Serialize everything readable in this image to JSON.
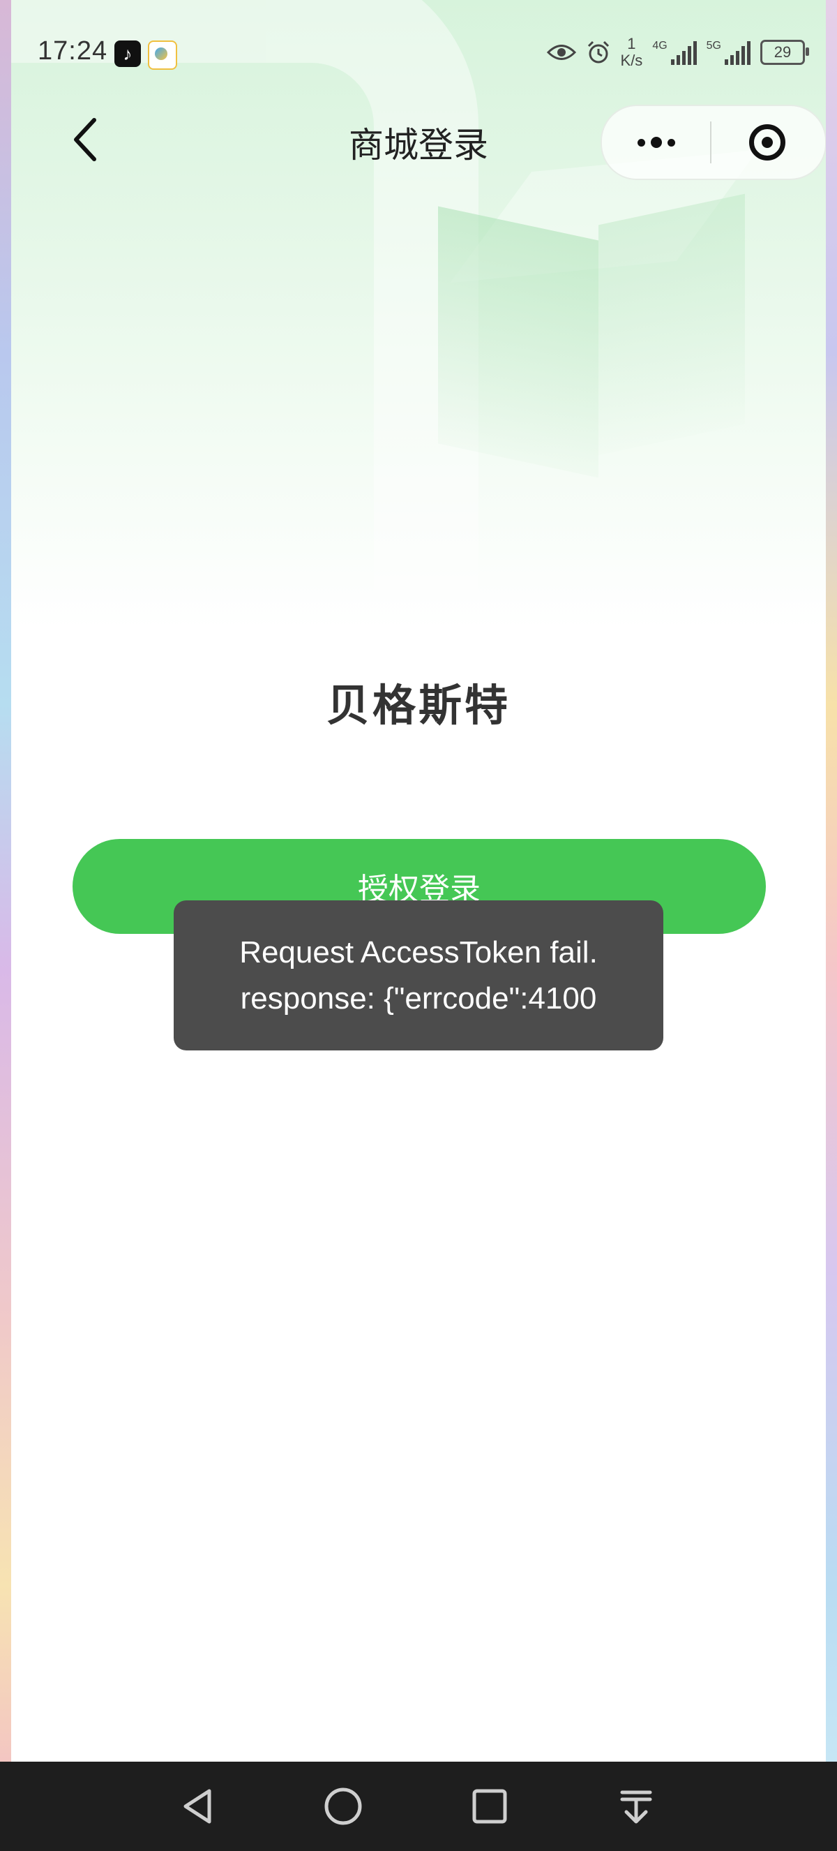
{
  "status_bar": {
    "time": "17:24",
    "net_speed_value": "1",
    "net_speed_unit": "K/s",
    "signal_1_label": "4G",
    "signal_2_label": "5G",
    "battery": "29"
  },
  "nav": {
    "title": "商城登录"
  },
  "page": {
    "brand_name": "贝格斯特",
    "login_button_label": "授权登录"
  },
  "toast": {
    "line1": "Request AccessToken fail.",
    "line2": "response: {\"errcode\":4100"
  },
  "colors": {
    "primary_green": "#45c755",
    "toast_bg": "#4c4c4c",
    "system_nav_bg": "#1e1e1e"
  },
  "icons": {
    "back": "chevron-left-icon",
    "more": "more-dots-icon",
    "close": "target-circle-icon",
    "eye": "eye-icon",
    "alarm": "alarm-icon",
    "sys_back": "triangle-back-icon",
    "sys_home": "circle-home-icon",
    "sys_recent": "square-recent-icon",
    "sys_menu": "download-arrow-icon"
  }
}
